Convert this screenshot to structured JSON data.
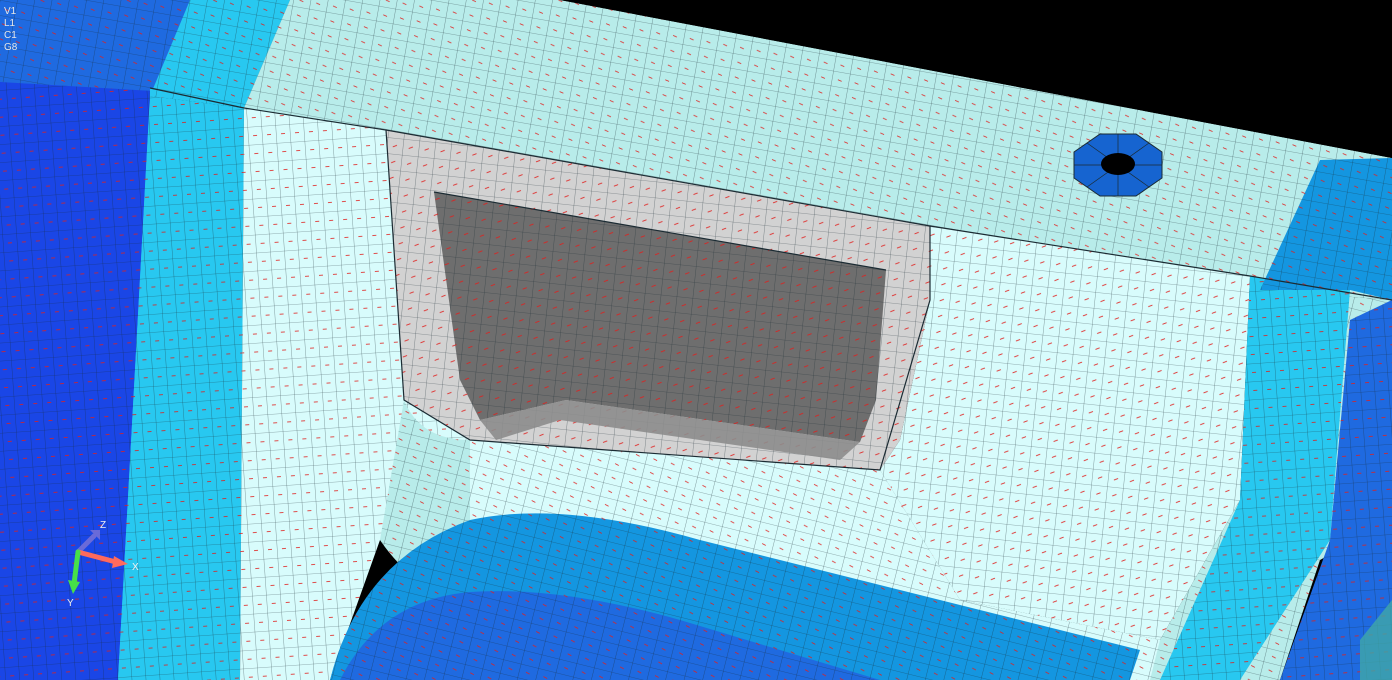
{
  "viewport": {
    "name": "fem-mesh-viewport",
    "background": "#000000"
  },
  "overlay_labels": [
    "V1",
    "L1",
    "C1",
    "G8"
  ],
  "axis_triad": {
    "x": "X",
    "y": "Y",
    "z": "Z",
    "colors": {
      "x": "#ff6a5c",
      "y": "#46e04a",
      "z": "#6a6ad8"
    }
  },
  "colors": {
    "deep_blue": "#1a46e6",
    "royal_blue": "#1f6ae0",
    "medium_blue": "#1496e0",
    "light_blue": "#28c8f0",
    "pale_cyan": "#d8fcfc",
    "pale_aqua": "#b8ecea",
    "light_gray": "#d2d2d2",
    "dark_gray": "#6e6e6e",
    "mid_gray": "#8c8c8c",
    "mesh_line": "#1b2b33",
    "normal_marker": "#e0201e",
    "hole_ring": "#1664d0",
    "hole_center": "#000000"
  }
}
